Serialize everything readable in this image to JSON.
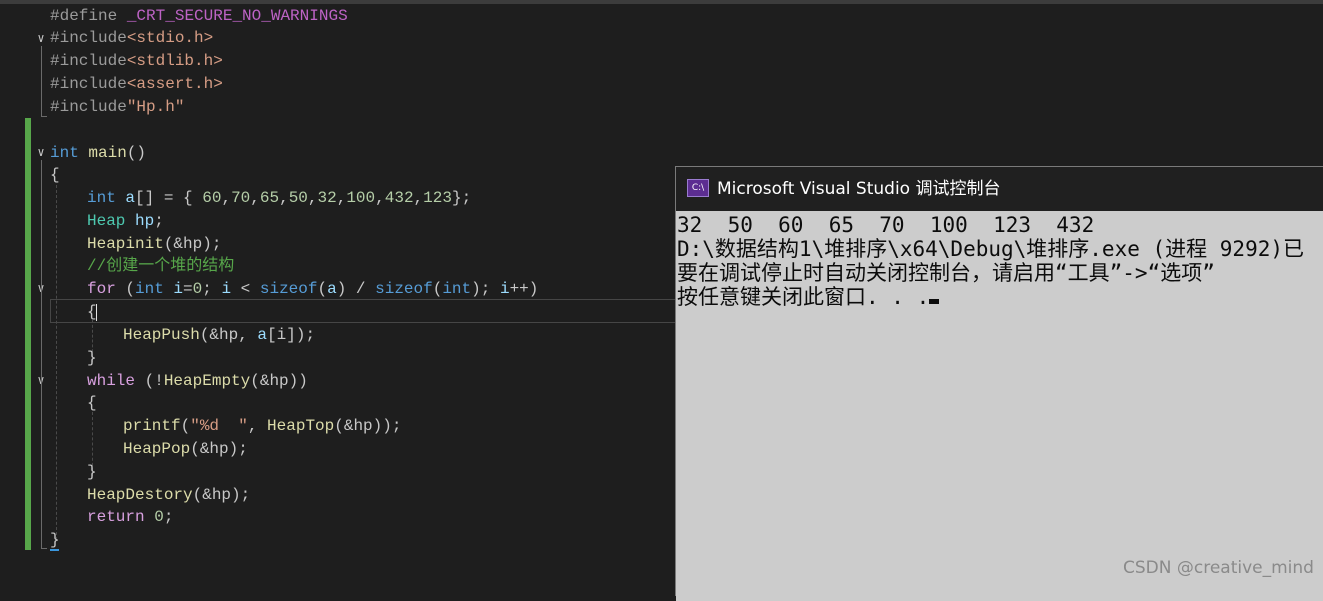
{
  "editor": {
    "lines": {
      "define": {
        "kw": "#define",
        "macro": "_CRT_SECURE_NO_WARNINGS"
      },
      "inc1": {
        "kw": "#include",
        "file": "<stdio.h>"
      },
      "inc2": {
        "kw": "#include",
        "file": "<stdlib.h>"
      },
      "inc3": {
        "kw": "#include",
        "file": "<assert.h>"
      },
      "inc4": {
        "kw": "#include",
        "file": "\"Hp.h\""
      },
      "main": {
        "type": "int",
        "name": "main",
        "parens": "()"
      },
      "open_brace": "{",
      "arr": {
        "type": "int",
        "name": "a",
        "rest": "[] = { ",
        "vals": [
          "60",
          "70",
          "65",
          "50",
          "32",
          "100",
          "432",
          "123"
        ],
        "end": "};"
      },
      "heap": {
        "type": "Heap",
        "name": "hp",
        "end": ";"
      },
      "init": {
        "func": "Heapinit",
        "arg": "(&hp);"
      },
      "comment": "//创建一个堆的结构",
      "for": {
        "kw": "for",
        "t1": " (",
        "type": "int",
        "var": " i",
        "t2": "=",
        "n0": "0",
        "t3": "; ",
        "i": "i",
        "t4": " < ",
        "sz": "sizeof",
        "t5": "(",
        "a": "a",
        "t6": ") / ",
        "sz2": "sizeof",
        "t7": "(",
        "type2": "int",
        "t8": "); ",
        "i2": "i",
        "t9": "++)"
      },
      "for_open": "{",
      "push": {
        "func": "HeapPush",
        "arg": "(&hp, ",
        "a": "a",
        "idx": "[i]);"
      },
      "for_close": "}",
      "while": {
        "kw": "while",
        "t1": " (!",
        "func": "HeapEmpty",
        "arg": "(&hp))"
      },
      "while_open": "{",
      "printf": {
        "func": "printf",
        "t1": "(",
        "str": "\"%d  \"",
        "t2": ", ",
        "func2": "HeapTop",
        "arg": "(&hp));"
      },
      "pop": {
        "func": "HeapPop",
        "arg": "(&hp);"
      },
      "while_close": "}",
      "destroy": {
        "func": "HeapDestory",
        "arg": "(&hp);"
      },
      "ret": {
        "kw": "return",
        "val": "0",
        "end": ";"
      },
      "close_brace": "}"
    }
  },
  "console": {
    "icon_label": "C:\\",
    "title": "Microsoft Visual Studio 调试控制台",
    "output": [
      "32  50  60  65  70  100  123  432",
      "D:\\数据结构1\\堆排序\\x64\\Debug\\堆排序.exe (进程 9292)已",
      "要在调试停止时自动关闭控制台，请启用“工具”->“选项”",
      "按任意键关闭此窗口. . ."
    ]
  },
  "watermark": "CSDN @creative_mind"
}
